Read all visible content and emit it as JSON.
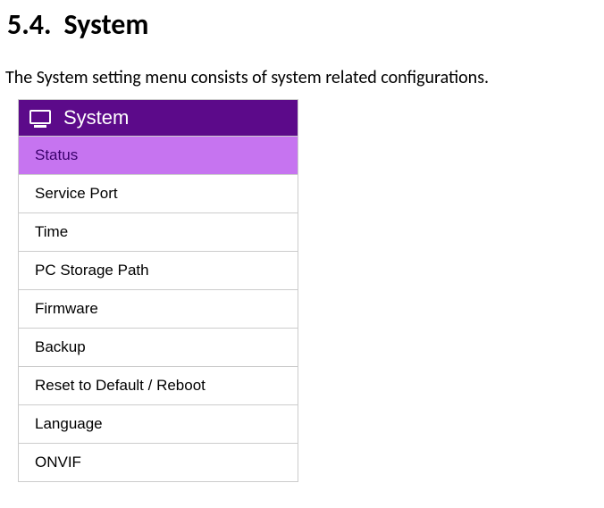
{
  "heading": {
    "number": "5.4.",
    "title": "System"
  },
  "description": "The System setting menu consists of system related configurations.",
  "menu": {
    "title": "System",
    "items": [
      {
        "label": "Status",
        "active": true
      },
      {
        "label": "Service Port",
        "active": false
      },
      {
        "label": "Time",
        "active": false
      },
      {
        "label": "PC Storage Path",
        "active": false
      },
      {
        "label": "Firmware",
        "active": false
      },
      {
        "label": "Backup",
        "active": false
      },
      {
        "label": "Reset to Default / Reboot",
        "active": false
      },
      {
        "label": "Language",
        "active": false
      },
      {
        "label": "ONVIF",
        "active": false
      }
    ]
  }
}
